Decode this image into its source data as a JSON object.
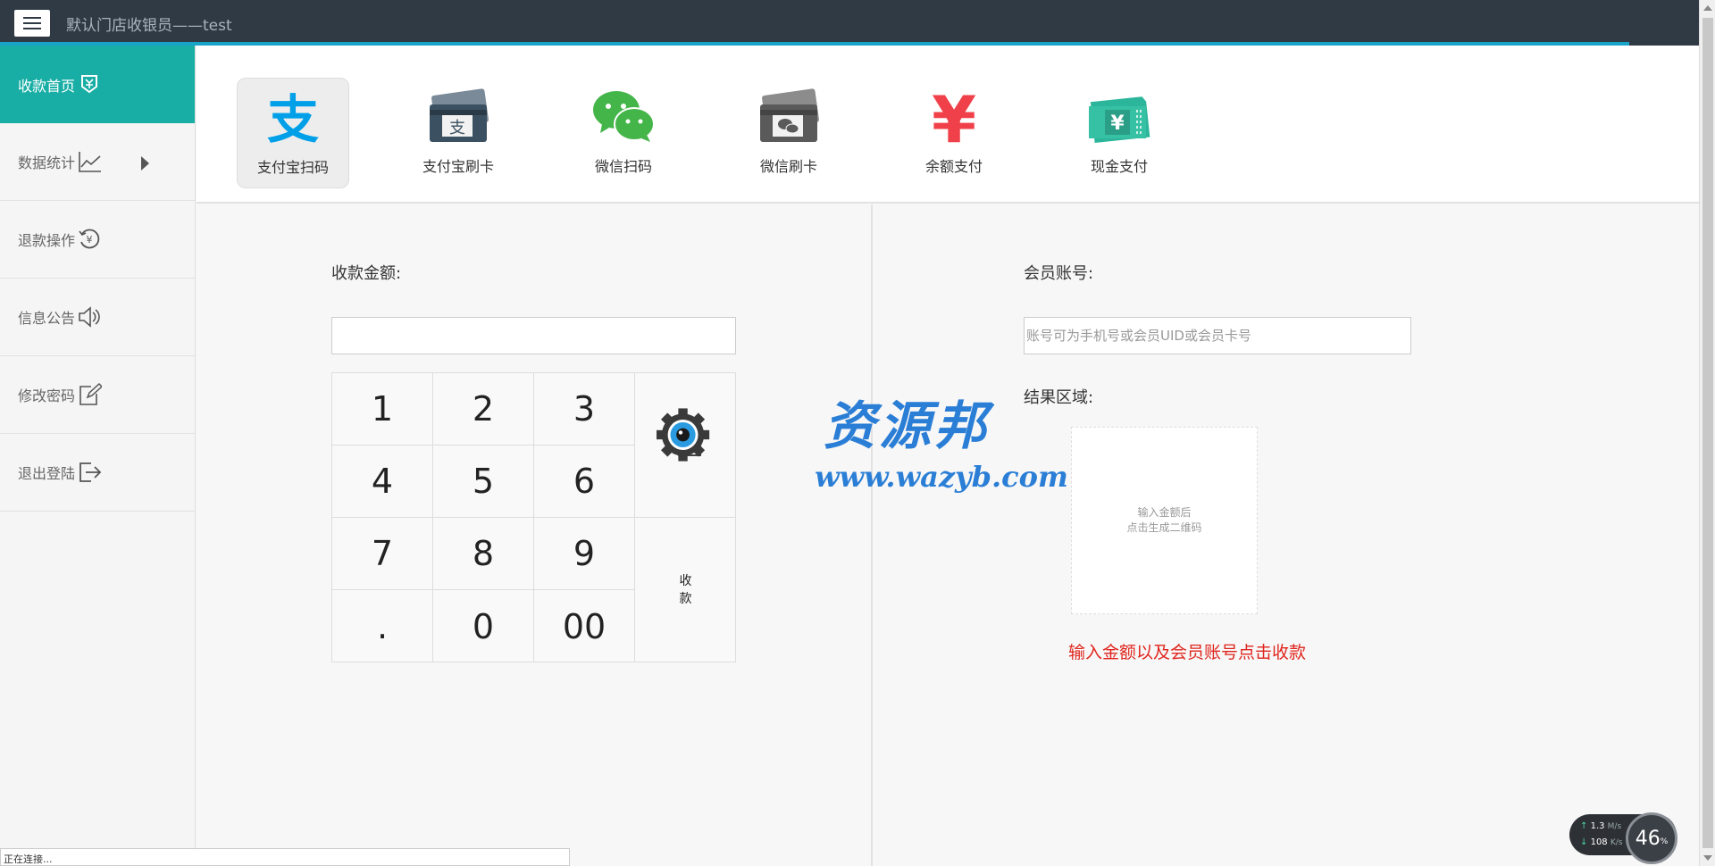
{
  "header": {
    "title": "默认门店收银员——test"
  },
  "sidebar": {
    "items": [
      {
        "label": "收款首页",
        "icon": "cash-register-icon",
        "active": true
      },
      {
        "label": "数据统计",
        "icon": "line-chart-icon",
        "has_submenu": true
      },
      {
        "label": "退款操作",
        "icon": "refund-yen-icon"
      },
      {
        "label": "信息公告",
        "icon": "speaker-icon"
      },
      {
        "label": "修改密码",
        "icon": "edit-icon"
      },
      {
        "label": "退出登陆",
        "icon": "logout-icon"
      }
    ]
  },
  "payment_methods": [
    {
      "label": "支付宝扫码",
      "icon": "alipay-icon",
      "active": true
    },
    {
      "label": "支付宝刷卡",
      "icon": "alipay-card-icon"
    },
    {
      "label": "微信扫码",
      "icon": "wechat-icon"
    },
    {
      "label": "微信刷卡",
      "icon": "wechat-card-icon"
    },
    {
      "label": "余额支付",
      "icon": "yen-icon"
    },
    {
      "label": "现金支付",
      "icon": "cash-ticket-icon"
    }
  ],
  "left_panel": {
    "amount_label": "收款金额:",
    "amount_value": ""
  },
  "keypad": {
    "keys": [
      "1",
      "2",
      "3",
      "4",
      "5",
      "6",
      "7",
      "8",
      "9",
      ".",
      "0",
      "00"
    ],
    "submit_label_top": "收",
    "submit_label_bottom": "款",
    "backspace_icon": "backspace-icon"
  },
  "right_panel": {
    "member_label": "会员账号:",
    "member_placeholder": "账号可为手机号或会员UID或会员卡号",
    "result_label": "结果区域:",
    "qr_line1": "输入金额后",
    "qr_line2": "点击生成二维码",
    "hint": "输入金额以及会员账号点击收款"
  },
  "watermark": {
    "title": "资源邦",
    "url": "www.wazyb.com"
  },
  "statusbar": {
    "text": "正在连接..."
  },
  "speed_widget": {
    "up": "1.3",
    "up_unit": "M/s",
    "down": "108",
    "down_unit": "K/s",
    "percent": "46",
    "percent_unit": "%"
  },
  "colors": {
    "topbar": "#2f3a45",
    "accent": "#19aea5",
    "progress": "#18a3c9",
    "hint": "#e0261e"
  }
}
